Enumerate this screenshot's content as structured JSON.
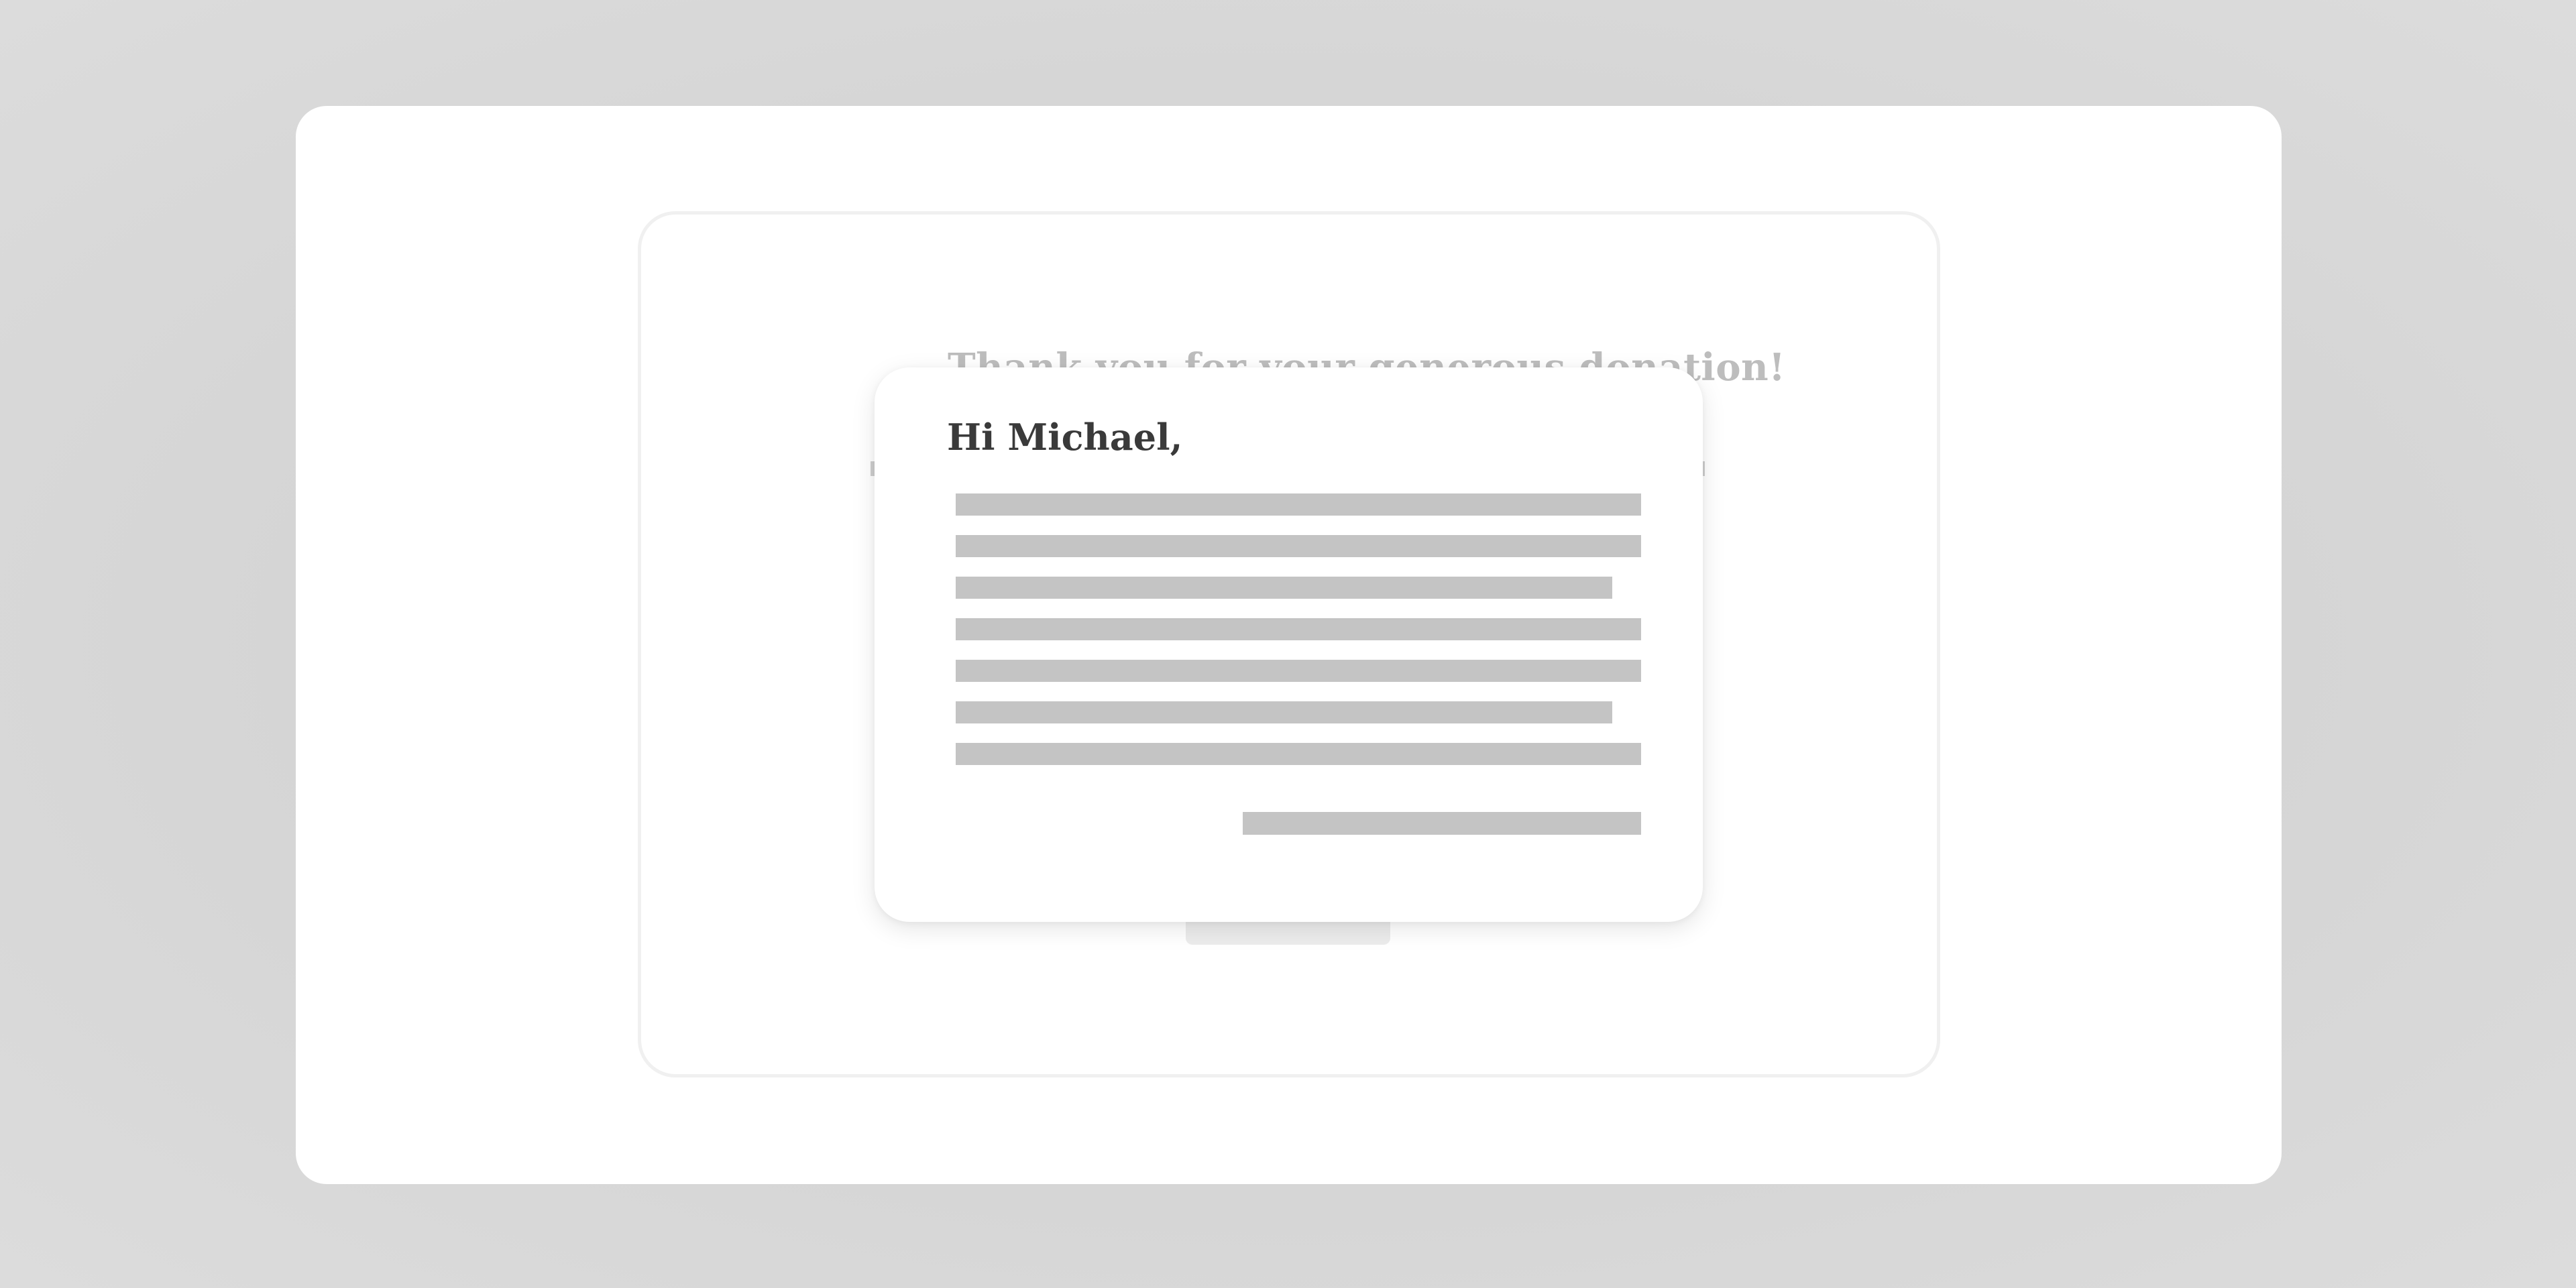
{
  "background_card": {
    "title": "Thank you for your generous donation!"
  },
  "letter": {
    "greeting": "Hi Michael,",
    "body_lines": [
      "full",
      "full",
      "short",
      "full",
      "full",
      "short",
      "full"
    ],
    "signoff": "placeholder"
  },
  "colors": {
    "page_background": "#d6d6d6",
    "card_background": "#ffffff",
    "placeholder_line": "#c4c4c4",
    "greeting_text": "#3a3a3a",
    "faded_title": "#bdbdbd"
  }
}
